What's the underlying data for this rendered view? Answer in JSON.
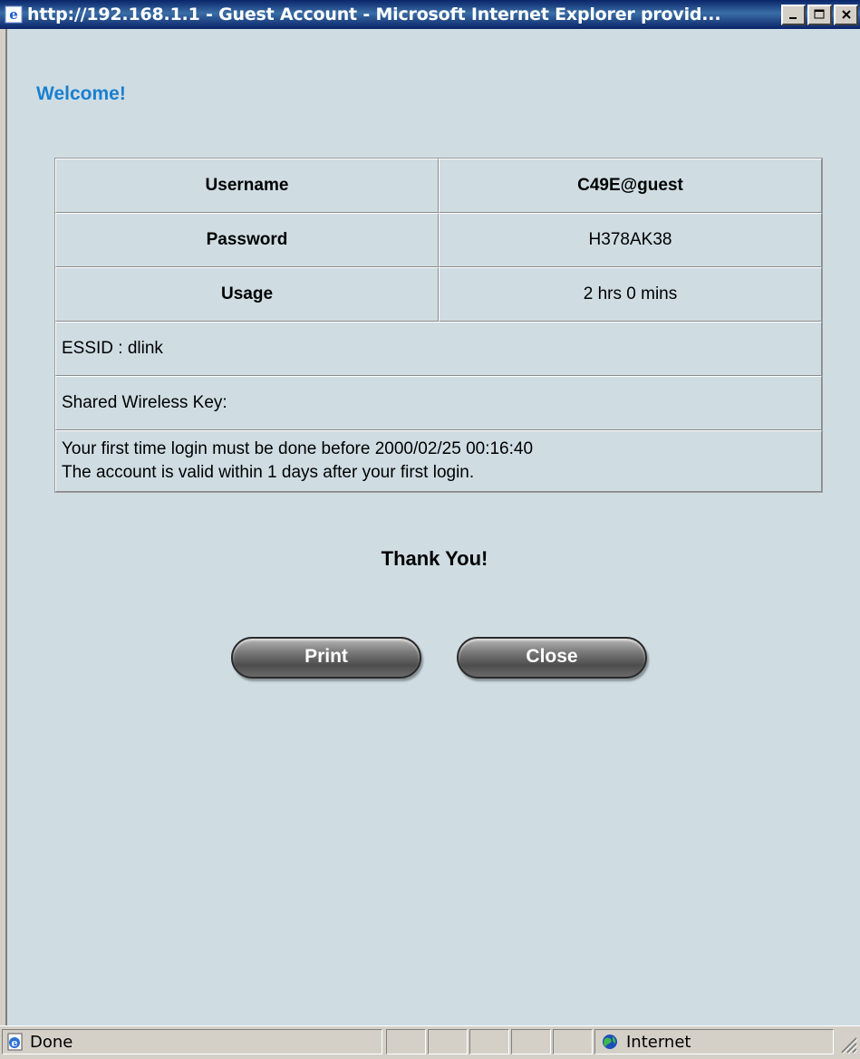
{
  "window": {
    "title": "http://192.168.1.1 - Guest Account - Microsoft Internet Explorer provid...",
    "controls": {
      "minimize": "_",
      "maximize": "□",
      "close": "X"
    }
  },
  "page": {
    "welcome": "Welcome!",
    "table": {
      "username_label": "Username",
      "username_value": "C49E@guest",
      "password_label": "Password",
      "password_value": "H378AK38",
      "usage_label": "Usage",
      "usage_value": "2 hrs 0 mins",
      "essid": "ESSID : dlink",
      "shared_key": "Shared Wireless Key:",
      "note_line1": "Your first time login must be done before 2000/02/25 00:16:40",
      "note_line2": "The account is valid within 1 days after your first login."
    },
    "thanks": "Thank You!",
    "buttons": {
      "print": "Print",
      "close": "Close"
    }
  },
  "statusbar": {
    "status": "Done",
    "zone": "Internet"
  },
  "colors": {
    "background": "#cfdde3",
    "welcome": "#1a7fd0",
    "titlebar": "#0a246a"
  },
  "icons": [
    "ie-page-icon",
    "minimize-icon",
    "maximize-icon",
    "close-icon",
    "ie-document-icon",
    "globe-icon",
    "resize-grip-icon"
  ]
}
